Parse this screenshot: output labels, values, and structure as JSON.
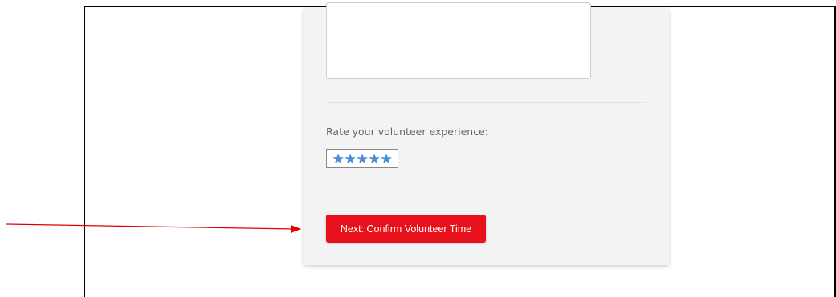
{
  "feedback": {
    "textarea_value": "",
    "rating_label": "Rate your volunteer experience:",
    "rating": {
      "value": 5,
      "max": 5,
      "star_color": "#4a90d9"
    }
  },
  "actions": {
    "next_label": "Next: Confirm Volunteer Time",
    "next_color": "#e8101b"
  },
  "annotation": {
    "arrow_color": "#e00000"
  }
}
